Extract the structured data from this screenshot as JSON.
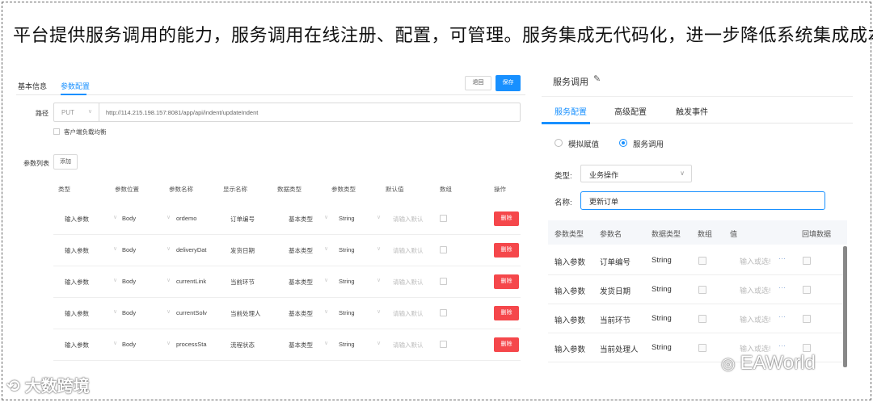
{
  "headline": "平台提供服务调用的能力，服务调用在线注册、配置，可管理。服务集成无代码化，进一步降低系统集成成本。",
  "left": {
    "tabs": [
      "基本信息",
      "参数配置"
    ],
    "back_label": "退回",
    "save_label": "保存",
    "path_label": "路径",
    "method": "PUT",
    "url": "http://114.215.198.157:8081/app/api/indent/updateIndent",
    "load_balance_label": "客户端负载均衡",
    "params_label": "参数列表",
    "add_label": "添加",
    "columns": [
      "类型",
      "参数位置",
      "参数名称",
      "显示名称",
      "数据类型",
      "参数类型",
      "默认值",
      "数组",
      "操作"
    ],
    "rows": [
      {
        "type": "输入参数",
        "position": "Body",
        "name": "ordemo",
        "display": "订单编号",
        "data_type": "基本类型",
        "param_type": "String",
        "default_ph": "请输入默认",
        "delete": "删除"
      },
      {
        "type": "输入参数",
        "position": "Body",
        "name": "deliveryDat",
        "display": "发货日期",
        "data_type": "基本类型",
        "param_type": "String",
        "default_ph": "请输入默认",
        "delete": "删除"
      },
      {
        "type": "输入参数",
        "position": "Body",
        "name": "currentLink",
        "display": "当前环节",
        "data_type": "基本类型",
        "param_type": "String",
        "default_ph": "请输入默认",
        "delete": "删除"
      },
      {
        "type": "输入参数",
        "position": "Body",
        "name": "currentSolv",
        "display": "当前处理人",
        "data_type": "基本类型",
        "param_type": "String",
        "default_ph": "请输入默认",
        "delete": "删除"
      },
      {
        "type": "输入参数",
        "position": "Body",
        "name": "processSta",
        "display": "流程状态",
        "data_type": "基本类型",
        "param_type": "String",
        "default_ph": "请输入默认",
        "delete": "删除"
      }
    ]
  },
  "right": {
    "title": "服务调用",
    "tabs": [
      "服务配置",
      "高级配置",
      "触发事件"
    ],
    "radio_mock": "模拟赋值",
    "radio_service": "服务调用",
    "type_label": "类型:",
    "type_value": "业务操作",
    "name_label": "名称:",
    "name_value": "更新订单",
    "columns": [
      "参数类型",
      "参数名",
      "数据类型",
      "数组",
      "值",
      "回填数据"
    ],
    "rows": [
      {
        "type": "输入参数",
        "name": "订单编号",
        "data_type": "String",
        "value_ph": "输入或选!",
        "dots": "···"
      },
      {
        "type": "输入参数",
        "name": "发货日期",
        "data_type": "String",
        "value_ph": "输入或选!",
        "dots": "···"
      },
      {
        "type": "输入参数",
        "name": "当前环节",
        "data_type": "String",
        "value_ph": "输入或选!",
        "dots": "···"
      },
      {
        "type": "输入参数",
        "name": "当前处理人",
        "data_type": "String",
        "value_ph": "输入或选!",
        "dots": "···"
      }
    ]
  },
  "watermarks": {
    "left": "大数跨境",
    "right": "EAWorld"
  }
}
